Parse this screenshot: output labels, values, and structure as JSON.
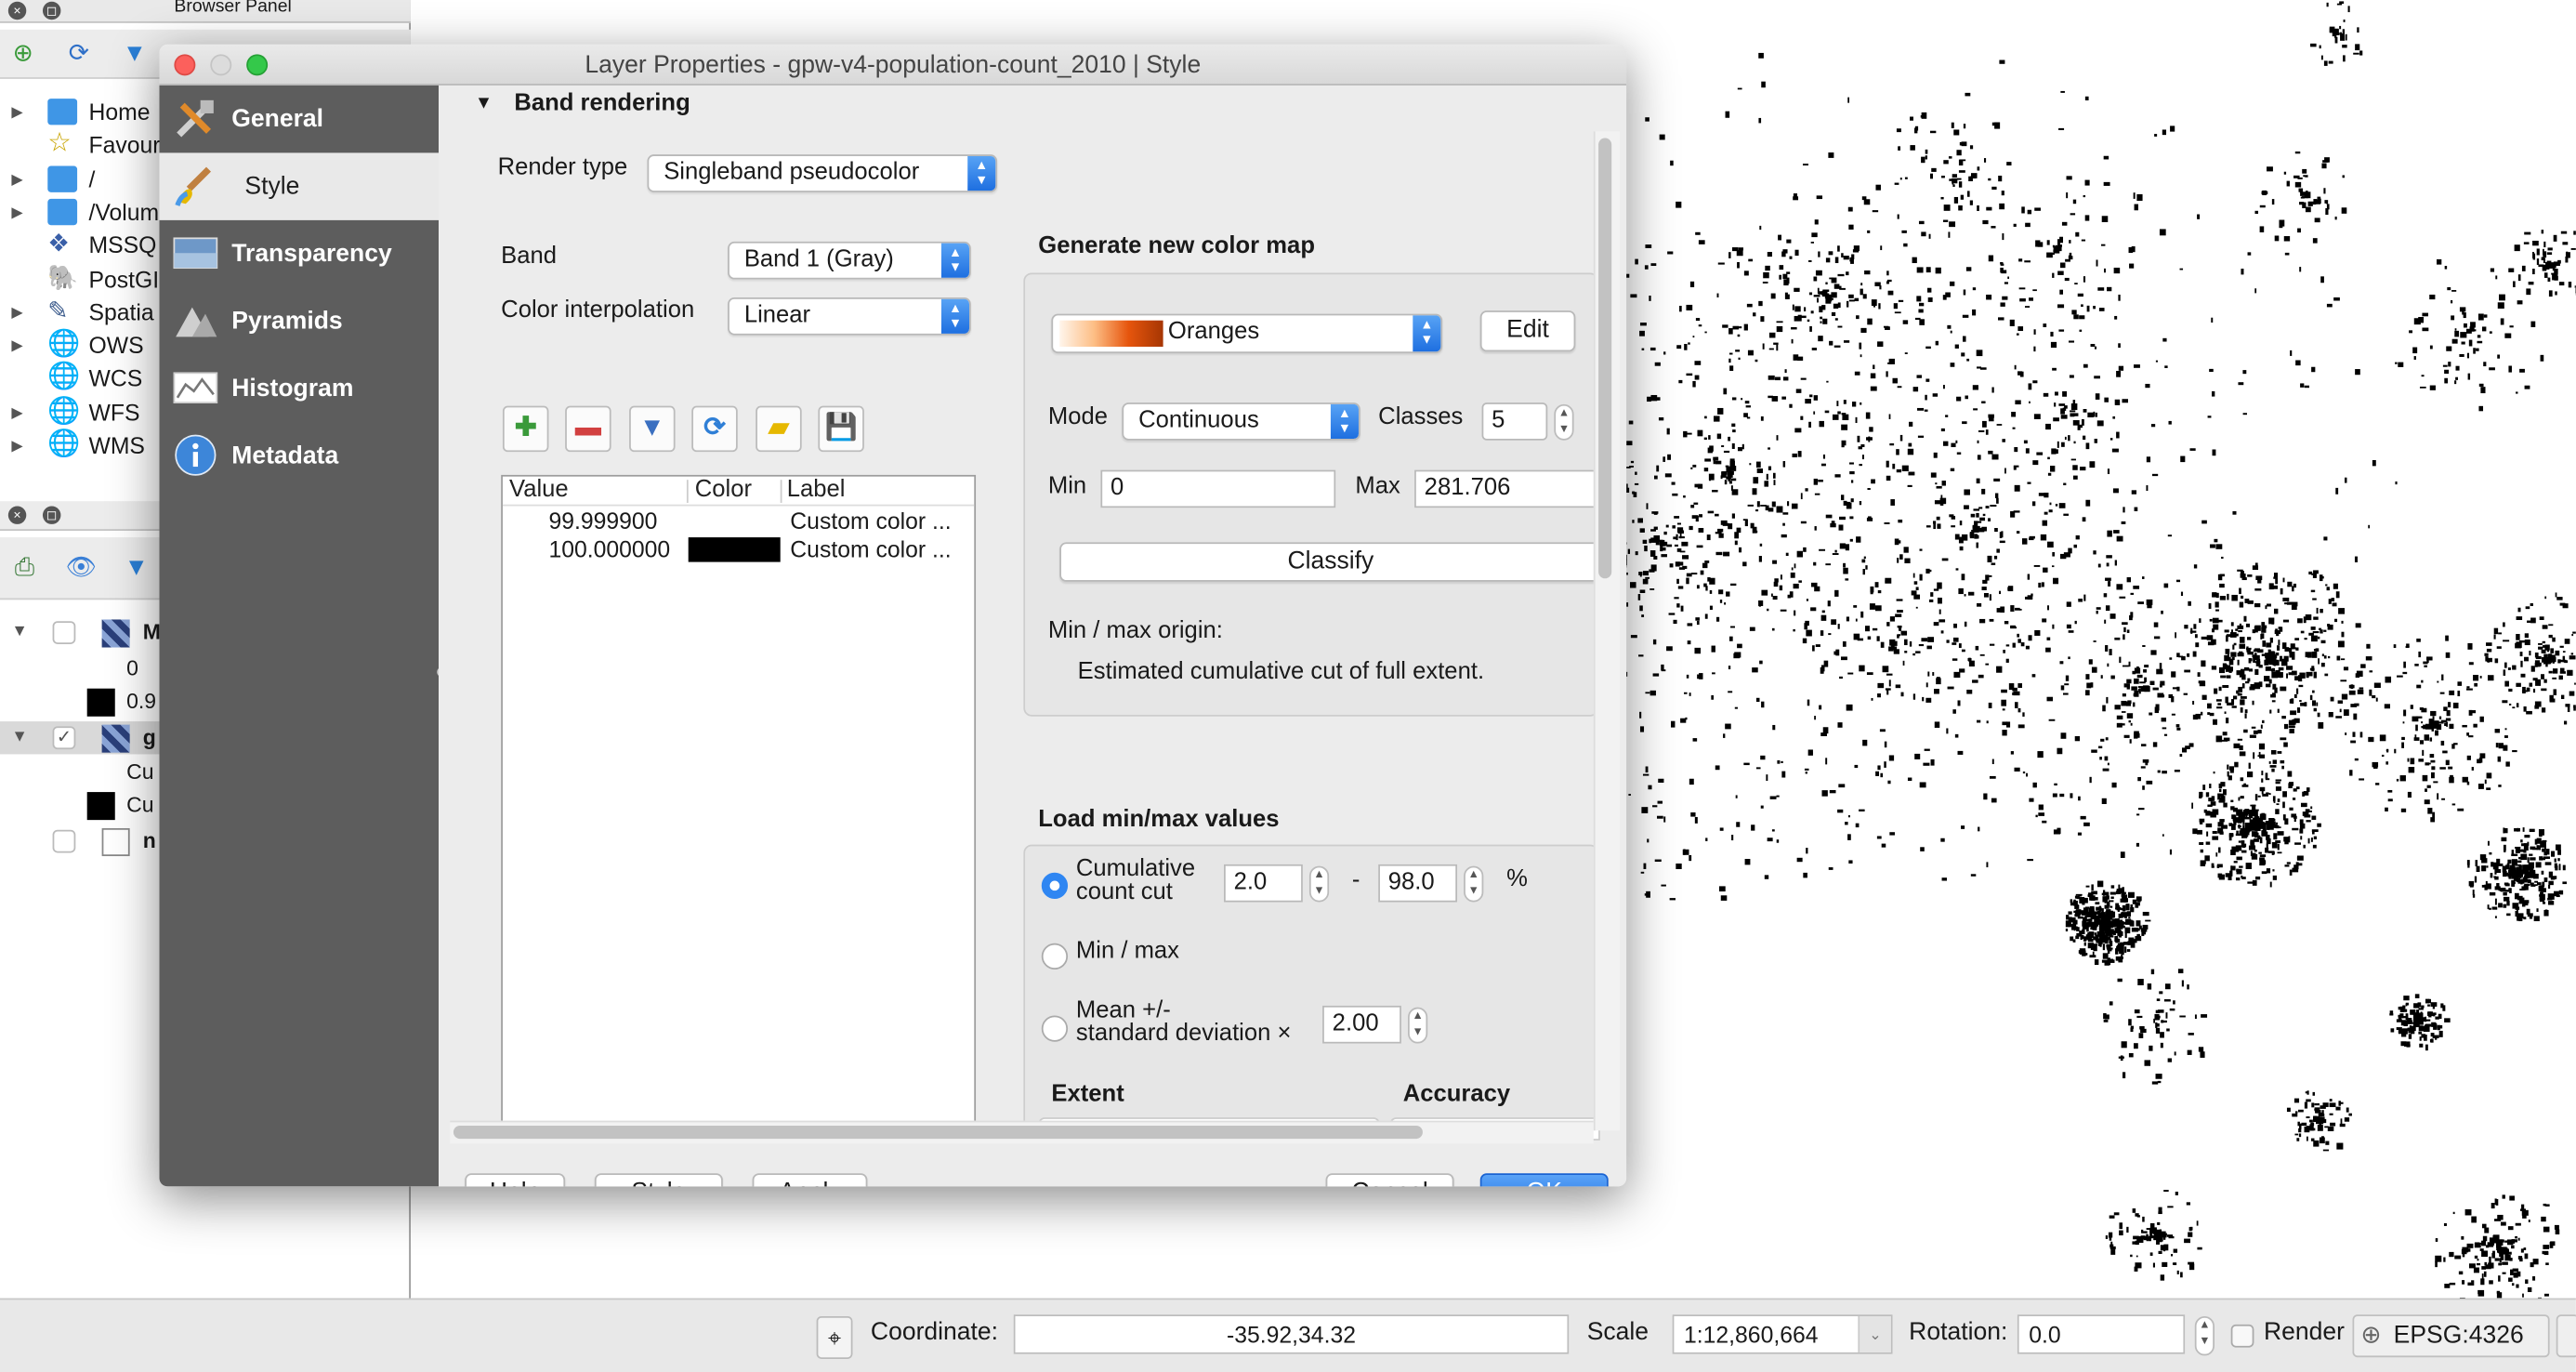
{
  "browser_panel": {
    "title": "Browser Panel",
    "items": [
      {
        "label": "Home",
        "expandable": true
      },
      {
        "label": "Favour",
        "expandable": false
      },
      {
        "label": "/",
        "expandable": true
      },
      {
        "label": "/Volum",
        "expandable": true
      },
      {
        "label": "MSSQ",
        "expandable": false
      },
      {
        "label": "PostGI",
        "expandable": false
      },
      {
        "label": "Spatia",
        "expandable": true
      },
      {
        "label": "OWS",
        "expandable": true
      },
      {
        "label": "WCS",
        "expandable": false
      },
      {
        "label": "WFS",
        "expandable": true
      },
      {
        "label": "WMS",
        "expandable": true
      }
    ]
  },
  "layers_panel": {
    "rows": [
      {
        "label": "M"
      },
      {
        "label": "0"
      },
      {
        "label": "0.9"
      },
      {
        "label": "g"
      },
      {
        "label": "Cu"
      },
      {
        "label": "Cu"
      },
      {
        "label": "n"
      }
    ]
  },
  "dialog": {
    "title": "Layer Properties - gpw-v4-population-count_2010 | Style",
    "sidebar": [
      {
        "label": "General",
        "icon": "tools-icon"
      },
      {
        "label": "Style",
        "icon": "paintbrush-icon",
        "active": true
      },
      {
        "label": "Transparency",
        "icon": "transparency-icon"
      },
      {
        "label": "Pyramids",
        "icon": "pyramids-icon"
      },
      {
        "label": "Histogram",
        "icon": "histogram-icon"
      },
      {
        "label": "Metadata",
        "icon": "info-icon"
      }
    ],
    "section_title": "Band rendering",
    "render_type_label": "Render type",
    "render_type_value": "Singleband pseudocolor",
    "band_label": "Band",
    "band_value": "Band 1 (Gray)",
    "interp_label": "Color interpolation",
    "interp_value": "Linear",
    "table": {
      "headers": [
        "Value",
        "Color",
        "Label"
      ],
      "rows": [
        {
          "value": "99.999900",
          "color": "#ffffff",
          "label": "Custom color ..."
        },
        {
          "value": "100.000000",
          "color": "#000000",
          "label": "Custom color ..."
        }
      ]
    },
    "colormap": {
      "title": "Generate new color map",
      "ramp_value": "Oranges",
      "ramp_colors": [
        "#fff5eb",
        "#fdbe85",
        "#e6550d",
        "#a63603"
      ],
      "edit_label": "Edit",
      "mode_label": "Mode",
      "mode_value": "Continuous",
      "classes_label": "Classes",
      "classes_value": "5",
      "min_label": "Min",
      "min_value": "0",
      "max_label": "Max",
      "max_value": "281.706",
      "classify_label": "Classify",
      "origin_label": "Min / max origin:",
      "origin_value": "Estimated cumulative cut of full extent."
    },
    "minmax": {
      "title": "Load min/max values",
      "cumulative_label_1": "Cumulative",
      "cumulative_label_2": "count cut",
      "cut_low": "2.0",
      "dash": "-",
      "cut_high": "98.0",
      "percent": "%",
      "minmax_label": "Min / max",
      "mean_label_1": "Mean +/-",
      "mean_label_2": "standard deviation ×",
      "stddev_value": "2.00",
      "extent_label": "Extent",
      "accuracy_label": "Accuracy",
      "selected_option": "Cumulative count cut"
    },
    "buttons": {
      "help": "Help",
      "style": "Style",
      "apply": "Apply",
      "cancel": "Cancel",
      "ok": "OK"
    }
  },
  "status_bar": {
    "coordinate_label": "Coordinate:",
    "coordinate_value": "-35.92,34.32",
    "scale_label": "Scale",
    "scale_value": "1:12,860,664",
    "rotation_label": "Rotation:",
    "rotation_value": "0.0",
    "render_label": "Render",
    "crs_value": "EPSG:4326"
  }
}
